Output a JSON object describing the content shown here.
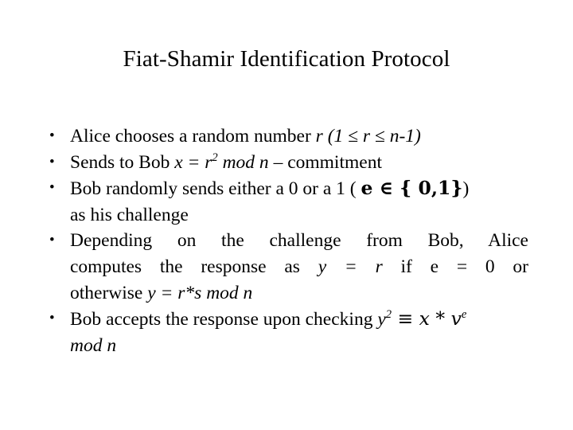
{
  "slide": {
    "title": "Fiat-Shamir Identification Protocol",
    "background_color": "#ffffff",
    "text_color": "#000000",
    "bullet_glyph": "•",
    "bullets": [
      {
        "id": "bullet-alice-random",
        "plain_text": "Alice chooses a random number r (1 ≤ r ≤ n-1)",
        "segments": [
          {
            "text": "Alice chooses a random number ",
            "style": "normal"
          },
          {
            "text": "r (1 ≤ r ≤ n-1)",
            "style": "italic"
          }
        ]
      },
      {
        "id": "bullet-sends-commitment",
        "plain_text": "Sends to Bob x = r2 mod n – commitment",
        "segments": [
          {
            "text": "Sends to Bob ",
            "style": "normal"
          },
          {
            "text": "x = r",
            "style": "italic"
          },
          {
            "text": "2",
            "style": "italic-superscript"
          },
          {
            "text": " mod n",
            "style": "italic"
          },
          {
            "text": " – commitment",
            "style": "normal"
          }
        ]
      },
      {
        "id": "bullet-bob-challenge",
        "plain_text": "Bob randomly sends either a 0 or a 1 ( e ∈ { 0,1}) as his challenge",
        "segments": [
          {
            "text": "Bob randomly sends either a 0 or a 1 ( ",
            "style": "normal"
          },
          {
            "text": "e ∈ { 0,1}",
            "style": "bold"
          },
          {
            "text": ")",
            "style": "normal"
          },
          {
            "text": " as his challenge",
            "style": "normal"
          }
        ],
        "lines": [
          "Bob randomly sends either a 0 or a 1 ( e ∈ { 0,1})",
          "as his challenge"
        ]
      },
      {
        "id": "bullet-depending-response",
        "plain_text": "Depending on the challenge from Bob, Alice computes the response as y = r if e = 0 or otherwise y = r*s mod n",
        "justified": true,
        "segments": [
          {
            "text": "Depending on the challenge from Bob, Alice computes the response as ",
            "style": "normal"
          },
          {
            "text": "y = r",
            "style": "italic"
          },
          {
            "text": " if e = 0 or otherwise ",
            "style": "normal"
          },
          {
            "text": "y = r*s mod n",
            "style": "italic"
          }
        ],
        "lines": [
          "Depending on the challenge from Bob, Alice",
          "computes the response as y = r if e = 0 or",
          "otherwise y = r*s mod n"
        ]
      },
      {
        "id": "bullet-bob-accepts",
        "plain_text": "Bob accepts the response upon checking y2 ≡ x * ve mod n",
        "segments": [
          {
            "text": "Bob accepts the response upon checking ",
            "style": "normal"
          },
          {
            "text": "y",
            "style": "italic"
          },
          {
            "text": "2",
            "style": "italic-superscript"
          },
          {
            "text": " ≡ x * v",
            "style": "italic"
          },
          {
            "text": "e",
            "style": "italic-superscript"
          },
          {
            "text": " mod n",
            "style": "italic"
          }
        ],
        "lines": [
          "Bob accepts the response upon checking y2 ≡ x * ve",
          "mod n"
        ]
      }
    ],
    "text_fragments": {
      "b1_pre": "Alice chooses a random number ",
      "b1_math": "r (1 ≤ r ≤ n-1)",
      "b2_pre": "Sends to Bob ",
      "b2_math_a": "x = r",
      "b2_sup": "2",
      "b2_math_b": " mod n",
      "b2_post": " – commitment",
      "b3_pre": "Bob randomly sends either a 0 or a 1 ( ",
      "b3_bold": "e ∈ { 0,1}",
      "b3_post": ")",
      "b3_line2": "as his challenge",
      "b4_l1": "Depending on the challenge from Bob, Alice",
      "b4_l2_pre": "computes the response as ",
      "b4_l2_math": "y = r",
      "b4_l2_post": " if e = 0 or",
      "b4_l3_pre": "otherwise ",
      "b4_l3_math": "y = r*s mod n",
      "b5_pre": "Bob accepts the response upon checking ",
      "b5_y": "y",
      "b5_y_sup": "2",
      "b5_mid": " ≡ x * v",
      "b5_v_sup": "e",
      "b5_l2": "mod n"
    }
  }
}
